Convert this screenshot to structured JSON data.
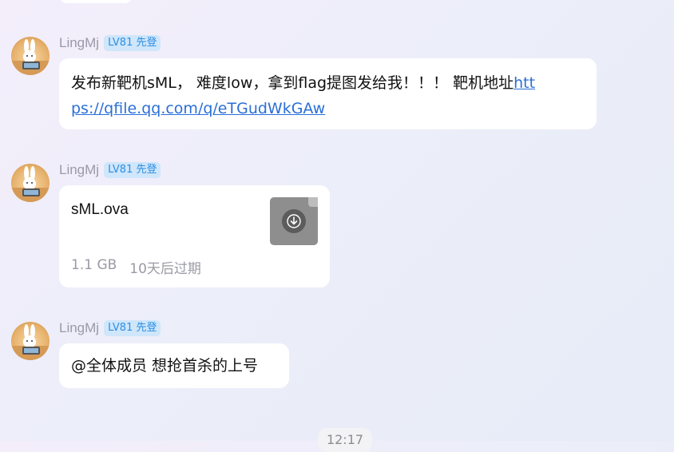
{
  "messages": [
    {
      "sender": "LingMj",
      "badge": "LV81 先登",
      "text": "发布新靶机sML， 难度low，拿到flag提图发给我！！！ 靶机地址",
      "link_part1": "htt",
      "link_part2": "ps://qfile.qq.com/q/eTGudWkGAw"
    },
    {
      "sender": "LingMj",
      "badge": "LV81 先登",
      "file": {
        "name": "sML.ova",
        "size": "1.1 GB",
        "expiry": "10天后过期",
        "icon": "download-icon"
      }
    },
    {
      "sender": "LingMj",
      "badge": "LV81 先登",
      "text": "@全体成员 想抢首杀的上号"
    }
  ],
  "timestamp": "12:17",
  "colors": {
    "badge_bg": "#cfe6fb",
    "badge_text": "#2e8fe0",
    "link": "#2a6fd6",
    "bubble": "#ffffff"
  }
}
